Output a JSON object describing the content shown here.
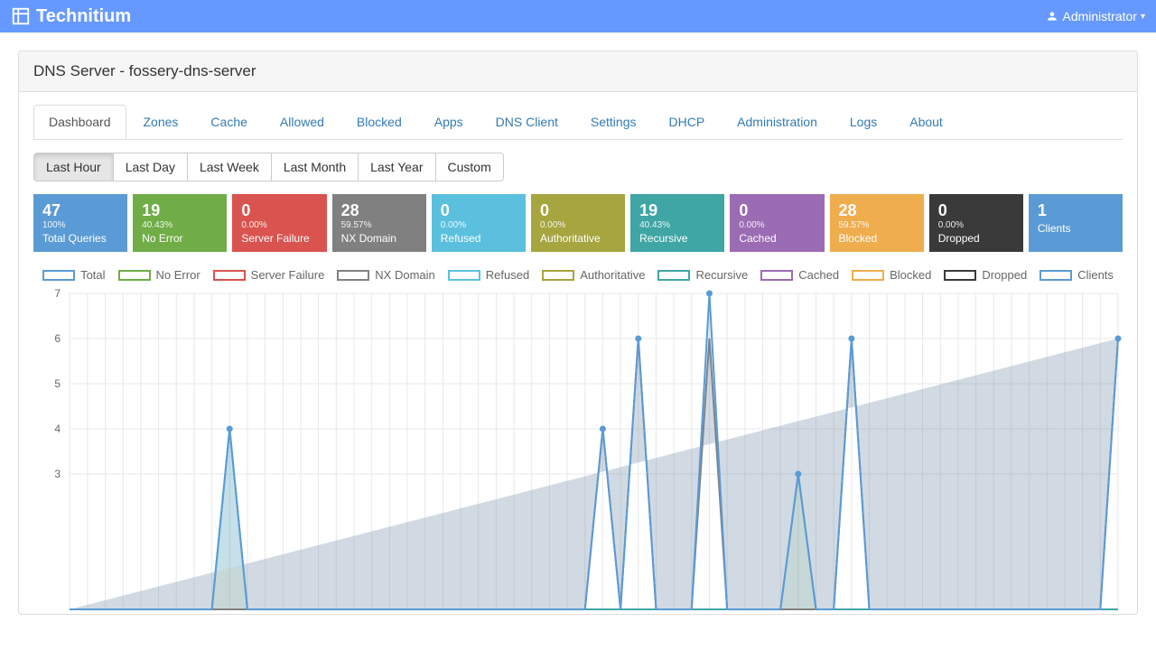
{
  "brand": "Technitium",
  "user": "Administrator",
  "page_title": "DNS Server - fossery-dns-server",
  "tabs": [
    {
      "label": "Dashboard",
      "active": true
    },
    {
      "label": "Zones"
    },
    {
      "label": "Cache"
    },
    {
      "label": "Allowed"
    },
    {
      "label": "Blocked"
    },
    {
      "label": "Apps"
    },
    {
      "label": "DNS Client"
    },
    {
      "label": "Settings"
    },
    {
      "label": "DHCP"
    },
    {
      "label": "Administration"
    },
    {
      "label": "Logs"
    },
    {
      "label": "About"
    }
  ],
  "time_ranges": [
    {
      "label": "Last Hour",
      "active": true
    },
    {
      "label": "Last Day"
    },
    {
      "label": "Last Week"
    },
    {
      "label": "Last Month"
    },
    {
      "label": "Last Year"
    },
    {
      "label": "Custom"
    }
  ],
  "stats": [
    {
      "value": "47",
      "pct": "100%",
      "label": "Total Queries",
      "bg": "#5b9bd5"
    },
    {
      "value": "19",
      "pct": "40.43%",
      "label": "No Error",
      "bg": "#70ad47"
    },
    {
      "value": "0",
      "pct": "0.00%",
      "label": "Server Failure",
      "bg": "#d9534f"
    },
    {
      "value": "28",
      "pct": "59.57%",
      "label": "NX Domain",
      "bg": "#808080"
    },
    {
      "value": "0",
      "pct": "0.00%",
      "label": "Refused",
      "bg": "#5bc0de"
    },
    {
      "value": "0",
      "pct": "0.00%",
      "label": "Authoritative",
      "bg": "#a6a53f"
    },
    {
      "value": "19",
      "pct": "40.43%",
      "label": "Recursive",
      "bg": "#3fa5a5"
    },
    {
      "value": "0",
      "pct": "0.00%",
      "label": "Cached",
      "bg": "#9b6bb3"
    },
    {
      "value": "28",
      "pct": "59.57%",
      "label": "Blocked",
      "bg": "#f0ad4e"
    },
    {
      "value": "0",
      "pct": "0.00%",
      "label": "Dropped",
      "bg": "#3a3a3a"
    },
    {
      "value": "1",
      "pct": "",
      "label": "Clients",
      "bg": "#5b9bd5"
    }
  ],
  "legend": [
    {
      "label": "Total",
      "color": "#5b9bd5"
    },
    {
      "label": "No Error",
      "color": "#70ad47"
    },
    {
      "label": "Server Failure",
      "color": "#d9534f"
    },
    {
      "label": "NX Domain",
      "color": "#808080"
    },
    {
      "label": "Refused",
      "color": "#5bc0de"
    },
    {
      "label": "Authoritative",
      "color": "#a6a53f"
    },
    {
      "label": "Recursive",
      "color": "#3fa5a5"
    },
    {
      "label": "Cached",
      "color": "#9b6bb3"
    },
    {
      "label": "Blocked",
      "color": "#f0ad4e"
    },
    {
      "label": "Dropped",
      "color": "#3a3a3a"
    },
    {
      "label": "Clients",
      "color": "#5b9bd5"
    }
  ],
  "chart_data": {
    "type": "line",
    "ylim": [
      0,
      7
    ],
    "yticks": [
      3,
      4,
      5,
      6,
      7
    ],
    "x_count": 60,
    "series": [
      {
        "name": "Total",
        "color": "#5b9bd5",
        "fill": "rgba(91,155,213,0.15)",
        "dots": true,
        "values": [
          0,
          0,
          0,
          0,
          0,
          0,
          0,
          0,
          0,
          4,
          0,
          0,
          0,
          0,
          0,
          0,
          0,
          0,
          0,
          0,
          0,
          0,
          0,
          0,
          0,
          0,
          0,
          0,
          0,
          0,
          4,
          0,
          6,
          0,
          0,
          0,
          7,
          0,
          0,
          0,
          0,
          3,
          0,
          0,
          6,
          0,
          0,
          0,
          0,
          0,
          0,
          0,
          0,
          0,
          0,
          0,
          0,
          0,
          0,
          6
        ]
      },
      {
        "name": "NX Domain",
        "color": "#808080",
        "fill": "rgba(128,128,128,0.20)",
        "dots": false,
        "values": [
          0,
          0,
          0,
          0,
          0,
          0,
          0,
          0,
          0,
          0,
          0,
          0,
          0,
          0,
          0,
          0,
          0,
          0,
          0,
          0,
          0,
          0,
          0,
          0,
          0,
          0,
          0,
          0,
          0,
          0,
          4,
          0,
          6,
          0,
          0,
          0,
          6,
          0,
          0,
          0,
          0,
          0,
          0,
          0,
          6,
          0,
          0,
          0,
          0,
          0,
          0,
          0,
          0,
          0,
          0,
          0,
          0,
          0,
          0,
          6
        ]
      },
      {
        "name": "Recursive",
        "color": "#3fa5a5",
        "fill": "rgba(63,165,165,0.20)",
        "dots": false,
        "values": [
          0,
          0,
          0,
          0,
          0,
          0,
          0,
          0,
          0,
          4,
          0,
          0,
          0,
          0,
          0,
          0,
          0,
          0,
          0,
          0,
          0,
          0,
          0,
          0,
          0,
          0,
          0,
          0,
          0,
          0,
          0,
          0,
          0,
          0,
          0,
          0,
          0,
          0,
          0,
          0,
          0,
          3,
          0,
          0,
          0,
          0,
          0,
          0,
          0,
          0,
          0,
          0,
          0,
          0,
          0,
          0,
          0,
          0,
          0,
          0
        ]
      }
    ]
  }
}
